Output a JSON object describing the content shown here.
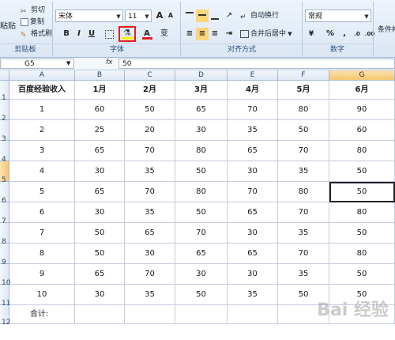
{
  "clipboard": {
    "cut": "剪切",
    "copy": "复制",
    "format_painter": "格式刷",
    "paste": "粘贴",
    "group": "剪贴板"
  },
  "font": {
    "name": "宋体",
    "size": "11",
    "grow": "A",
    "shrink": "A",
    "bold": "B",
    "italic": "I",
    "underline": "U",
    "font_color": "A",
    "phonetic": "变",
    "group": "字体"
  },
  "alignment": {
    "wrap": "自动换行",
    "merge": "合并后居中",
    "group": "对齐方式"
  },
  "number": {
    "format": "常规",
    "percent": "%",
    "comma": ",",
    "group": "数字"
  },
  "styles": {
    "conditional": "条件格"
  },
  "formula_bar": {
    "name_box": "G5",
    "fx": "fx",
    "value": "50"
  },
  "columns": [
    "A",
    "B",
    "C",
    "D",
    "E",
    "F",
    "G"
  ],
  "rows": [
    "1",
    "2",
    "3",
    "4",
    "5",
    "6",
    "7",
    "8",
    "9",
    "10",
    "11",
    "12"
  ],
  "headers": [
    "百度经验收入",
    "1月",
    "2月",
    "3月",
    "4月",
    "5月",
    "6月"
  ],
  "table": [
    [
      "1",
      "60",
      "50",
      "65",
      "70",
      "80",
      "90"
    ],
    [
      "2",
      "25",
      "20",
      "30",
      "35",
      "50",
      "60"
    ],
    [
      "3",
      "65",
      "70",
      "80",
      "65",
      "70",
      "80"
    ],
    [
      "4",
      "30",
      "35",
      "50",
      "30",
      "35",
      "50"
    ],
    [
      "5",
      "65",
      "70",
      "80",
      "70",
      "80",
      "50"
    ],
    [
      "6",
      "30",
      "35",
      "50",
      "65",
      "70",
      "80"
    ],
    [
      "7",
      "50",
      "65",
      "70",
      "30",
      "35",
      "50"
    ],
    [
      "8",
      "50",
      "30",
      "65",
      "65",
      "70",
      "80"
    ],
    [
      "9",
      "65",
      "70",
      "30",
      "30",
      "35",
      "50"
    ],
    [
      "10",
      "30",
      "35",
      "50",
      "35",
      "50",
      "50"
    ]
  ],
  "total_label": "合计:",
  "watermark": "Bai 经验"
}
